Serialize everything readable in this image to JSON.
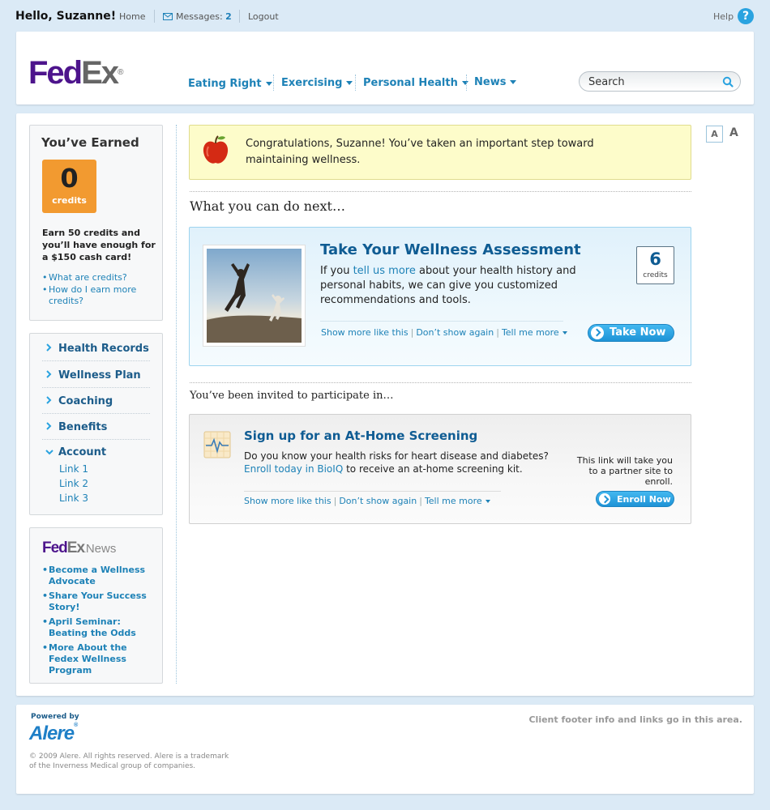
{
  "topbar": {
    "greeting": "Hello, Suzanne!",
    "home": "Home",
    "messages_label": "Messages:",
    "messages_count": "2",
    "logout": "Logout",
    "help": "Help",
    "help_icon": "?"
  },
  "header": {
    "logo_fed": "Fed",
    "logo_ex": "Ex",
    "logo_reg": "®",
    "nav": [
      "Eating Right",
      "Exercising",
      "Personal Health",
      "News"
    ],
    "search_value": "Search"
  },
  "earned": {
    "title": "You’ve Earned",
    "credits": "0",
    "credits_label": "credits",
    "text": "Earn 50 credits and you’ll have enough for a $150 cash card!",
    "links": [
      "What are credits?",
      "How do I earn more credits?"
    ]
  },
  "menu": {
    "items": [
      "Health Records",
      "Wellness Plan",
      "Coaching",
      "Benefits",
      "Account"
    ],
    "sub": [
      "Link 1",
      "Link 2",
      "Link 3"
    ]
  },
  "news": {
    "logo_fed": "Fed",
    "logo_ex": "Ex",
    "logo_dot": ".",
    "logo_news": "News",
    "links": [
      "Become a Wellness Advocate",
      "Share Your Success Story!",
      "April Seminar: Beating the Odds",
      "More About the Fedex Wellness Program"
    ]
  },
  "congrats": {
    "text": "Congratulations, Suzanne!  You’ve taken an important step toward maintaining wellness."
  },
  "next": {
    "heading": "What you can do next…"
  },
  "assessment": {
    "title": "Take Your Wellness Assessment",
    "text_before": "If you ",
    "text_link": "tell us more",
    "text_after": " about your health history and personal habits, we can give you customized recommendations and tools.",
    "credits": "6",
    "credits_label": "credits",
    "show_more": "Show more like this",
    "dont_show": "Don’t show again",
    "tell_more": "Tell me more",
    "button": "Take Now"
  },
  "invite": {
    "heading": "You’ve been invited to participate in…"
  },
  "screening": {
    "title": "Sign up for an At-Home Screening",
    "text_line1": "Do you know your health risks for heart disease and diabetes?",
    "text_link": "Enroll today in BioIQ",
    "text_after": " to receive an at-home screening kit.",
    "partner_note": "This link will take you to a partner site to enroll.",
    "show_more": "Show more like this",
    "dont_show": "Don’t show again",
    "tell_more": "Tell me more",
    "button": "Enroll Now"
  },
  "fontsize": {
    "small": "A",
    "large": "A"
  },
  "footer": {
    "powered_by": "Powered by",
    "brand": "Alere",
    "brand_mark": "®",
    "copyright": "© 2009 Alere. All rights reserved. Alere is a trademark of the Inverness Medical group of companies.",
    "client": "Client footer info and links go in this area."
  },
  "colors": {
    "accent": "#1e82b7",
    "fedex_purple": "#4d148c",
    "credits_orange": "#f29a30",
    "button_blue": "#2aa3e0"
  }
}
